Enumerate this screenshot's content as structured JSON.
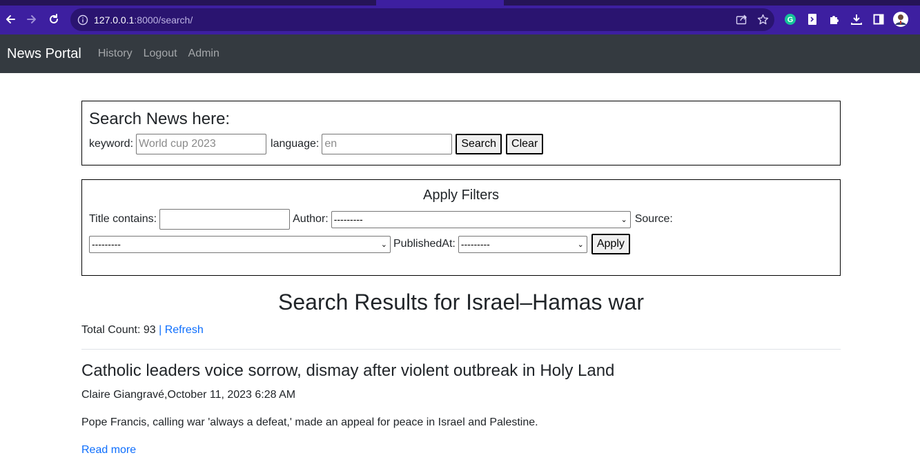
{
  "browser": {
    "url_host": "127.0.0.1",
    "url_rest": ":8000/search/",
    "accent": "#3d1fa0"
  },
  "navbar": {
    "brand": "News Portal",
    "links": [
      "History",
      "Logout",
      "Admin"
    ],
    "background": "#343a40"
  },
  "search": {
    "title": "Search News here:",
    "keyword_label": "keyword:",
    "keyword_placeholder": "World cup 2023",
    "language_label": "language:",
    "language_placeholder": "en",
    "search_button": "Search",
    "clear_button": "Clear"
  },
  "filters": {
    "title": "Apply Filters",
    "title_contains_label": "Title contains:",
    "author_label": "Author:",
    "author_value": "---------",
    "source_label": "Source:",
    "source_value": "---------",
    "published_label": "PublishedAt:",
    "published_value": "---------",
    "apply_button": "Apply"
  },
  "results": {
    "heading": "Search Results for Israel–Hamas war",
    "count_text": "Total Count: 93",
    "separator": "|",
    "refresh_link": "Refresh",
    "link_color": "#0d6efd"
  },
  "articles": [
    {
      "title": "Catholic leaders voice sorrow, dismay after violent outbreak in Holy Land",
      "meta": "Claire Giangravé,October 11, 2023 6:28 AM",
      "description": "Pope Francis, calling war 'always a defeat,' made an appeal for peace in Israel and Palestine.",
      "read_more": "Read more"
    }
  ],
  "icons": [
    "back-arrow-icon",
    "forward-arrow-icon",
    "reload-icon",
    "info-icon",
    "share-icon",
    "star-icon",
    "grammarly-icon",
    "extension-icon",
    "puzzle-icon",
    "download-icon",
    "sidepanel-icon",
    "profile-avatar"
  ]
}
